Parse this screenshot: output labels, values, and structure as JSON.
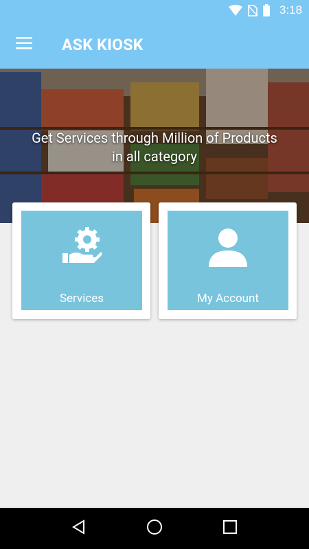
{
  "status_bar": {
    "time": "3:18",
    "icons": [
      "wifi-icon",
      "no-sim-icon",
      "battery-icon"
    ]
  },
  "app_bar": {
    "title": "ASK KIOSK",
    "menu_icon": "hamburger-menu-icon"
  },
  "hero": {
    "line1": "Get Services through Million of Products",
    "line2": "in all category"
  },
  "cards": [
    {
      "label": "Services",
      "icon": "gear-hand-icon"
    },
    {
      "label": "My Account",
      "icon": "user-icon"
    }
  ],
  "nav_bar": {
    "buttons": [
      "back-icon",
      "home-icon",
      "recents-icon"
    ]
  },
  "colors": {
    "primary": "#7cc8f4",
    "card_tile": "#78c4dd",
    "background": "#efefef"
  }
}
